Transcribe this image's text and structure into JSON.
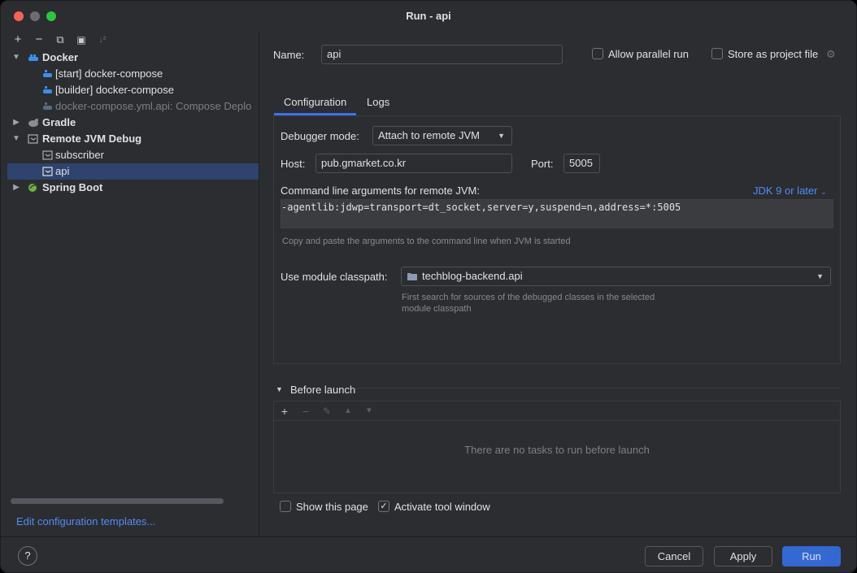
{
  "window": {
    "title": "Run - api"
  },
  "toolbar": {
    "add": "+",
    "remove": "−",
    "copy": "⧉",
    "folder": "▣",
    "sort": "↓²"
  },
  "tree": {
    "docker": {
      "label": "Docker"
    },
    "start_compose": {
      "label": "[start] docker-compose"
    },
    "builder_compose": {
      "label": "[builder] docker-compose"
    },
    "compose_yml": {
      "label": "docker-compose.yml.api: Compose Deplo"
    },
    "gradle": {
      "label": "Gradle"
    },
    "remote_jvm": {
      "label": "Remote JVM Debug"
    },
    "subscriber": {
      "label": "subscriber"
    },
    "api": {
      "label": "api"
    },
    "spring_boot": {
      "label": "Spring Boot"
    }
  },
  "edit_templates": "Edit configuration templates...",
  "form": {
    "name_label": "Name:",
    "name_value": "api",
    "allow_parallel": "Allow parallel run",
    "store_project": "Store as project file",
    "tabs": [
      "Configuration",
      "Logs"
    ],
    "debugger_mode_label": "Debugger mode:",
    "debugger_mode_value": "Attach to remote JVM",
    "host_label": "Host:",
    "host_value": "pub.gmarket.co.kr",
    "port_label": "Port:",
    "port_value": "5005",
    "cmd_label": "Command line arguments for remote JVM:",
    "jdk_link": "JDK 9 or later",
    "cmd_value": "-agentlib:jdwp=transport=dt_socket,server=y,suspend=n,address=*:5005",
    "cmd_hint": "Copy and paste the arguments to the command line when JVM is started",
    "module_label": "Use module classpath:",
    "module_value": "techblog-backend.api",
    "module_hint_1": "First search for sources of the debugged classes in the selected",
    "module_hint_2": "module classpath"
  },
  "before_launch": {
    "title": "Before launch",
    "empty": "There are no tasks to run before launch",
    "show_page": "Show this page",
    "activate_tool": "Activate tool window",
    "activate_checked": "✓"
  },
  "footer": {
    "help": "?",
    "cancel": "Cancel",
    "apply": "Apply",
    "run": "Run"
  }
}
